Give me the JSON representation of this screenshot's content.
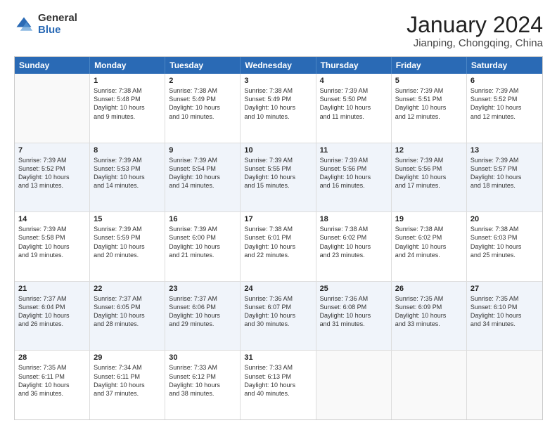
{
  "logo": {
    "general": "General",
    "blue": "Blue"
  },
  "title": "January 2024",
  "subtitle": "Jianping, Chongqing, China",
  "header_days": [
    "Sunday",
    "Monday",
    "Tuesday",
    "Wednesday",
    "Thursday",
    "Friday",
    "Saturday"
  ],
  "weeks": [
    [
      {
        "day": "",
        "info": "",
        "shaded": false,
        "empty": true
      },
      {
        "day": "1",
        "info": "Sunrise: 7:38 AM\nSunset: 5:48 PM\nDaylight: 10 hours\nand 9 minutes.",
        "shaded": false
      },
      {
        "day": "2",
        "info": "Sunrise: 7:38 AM\nSunset: 5:49 PM\nDaylight: 10 hours\nand 10 minutes.",
        "shaded": false
      },
      {
        "day": "3",
        "info": "Sunrise: 7:38 AM\nSunset: 5:49 PM\nDaylight: 10 hours\nand 10 minutes.",
        "shaded": false
      },
      {
        "day": "4",
        "info": "Sunrise: 7:39 AM\nSunset: 5:50 PM\nDaylight: 10 hours\nand 11 minutes.",
        "shaded": false
      },
      {
        "day": "5",
        "info": "Sunrise: 7:39 AM\nSunset: 5:51 PM\nDaylight: 10 hours\nand 12 minutes.",
        "shaded": false
      },
      {
        "day": "6",
        "info": "Sunrise: 7:39 AM\nSunset: 5:52 PM\nDaylight: 10 hours\nand 12 minutes.",
        "shaded": false
      }
    ],
    [
      {
        "day": "7",
        "info": "Sunrise: 7:39 AM\nSunset: 5:52 PM\nDaylight: 10 hours\nand 13 minutes.",
        "shaded": true
      },
      {
        "day": "8",
        "info": "Sunrise: 7:39 AM\nSunset: 5:53 PM\nDaylight: 10 hours\nand 14 minutes.",
        "shaded": true
      },
      {
        "day": "9",
        "info": "Sunrise: 7:39 AM\nSunset: 5:54 PM\nDaylight: 10 hours\nand 14 minutes.",
        "shaded": true
      },
      {
        "day": "10",
        "info": "Sunrise: 7:39 AM\nSunset: 5:55 PM\nDaylight: 10 hours\nand 15 minutes.",
        "shaded": true
      },
      {
        "day": "11",
        "info": "Sunrise: 7:39 AM\nSunset: 5:56 PM\nDaylight: 10 hours\nand 16 minutes.",
        "shaded": true
      },
      {
        "day": "12",
        "info": "Sunrise: 7:39 AM\nSunset: 5:56 PM\nDaylight: 10 hours\nand 17 minutes.",
        "shaded": true
      },
      {
        "day": "13",
        "info": "Sunrise: 7:39 AM\nSunset: 5:57 PM\nDaylight: 10 hours\nand 18 minutes.",
        "shaded": true
      }
    ],
    [
      {
        "day": "14",
        "info": "Sunrise: 7:39 AM\nSunset: 5:58 PM\nDaylight: 10 hours\nand 19 minutes.",
        "shaded": false
      },
      {
        "day": "15",
        "info": "Sunrise: 7:39 AM\nSunset: 5:59 PM\nDaylight: 10 hours\nand 20 minutes.",
        "shaded": false
      },
      {
        "day": "16",
        "info": "Sunrise: 7:39 AM\nSunset: 6:00 PM\nDaylight: 10 hours\nand 21 minutes.",
        "shaded": false
      },
      {
        "day": "17",
        "info": "Sunrise: 7:38 AM\nSunset: 6:01 PM\nDaylight: 10 hours\nand 22 minutes.",
        "shaded": false
      },
      {
        "day": "18",
        "info": "Sunrise: 7:38 AM\nSunset: 6:02 PM\nDaylight: 10 hours\nand 23 minutes.",
        "shaded": false
      },
      {
        "day": "19",
        "info": "Sunrise: 7:38 AM\nSunset: 6:02 PM\nDaylight: 10 hours\nand 24 minutes.",
        "shaded": false
      },
      {
        "day": "20",
        "info": "Sunrise: 7:38 AM\nSunset: 6:03 PM\nDaylight: 10 hours\nand 25 minutes.",
        "shaded": false
      }
    ],
    [
      {
        "day": "21",
        "info": "Sunrise: 7:37 AM\nSunset: 6:04 PM\nDaylight: 10 hours\nand 26 minutes.",
        "shaded": true
      },
      {
        "day": "22",
        "info": "Sunrise: 7:37 AM\nSunset: 6:05 PM\nDaylight: 10 hours\nand 28 minutes.",
        "shaded": true
      },
      {
        "day": "23",
        "info": "Sunrise: 7:37 AM\nSunset: 6:06 PM\nDaylight: 10 hours\nand 29 minutes.",
        "shaded": true
      },
      {
        "day": "24",
        "info": "Sunrise: 7:36 AM\nSunset: 6:07 PM\nDaylight: 10 hours\nand 30 minutes.",
        "shaded": true
      },
      {
        "day": "25",
        "info": "Sunrise: 7:36 AM\nSunset: 6:08 PM\nDaylight: 10 hours\nand 31 minutes.",
        "shaded": true
      },
      {
        "day": "26",
        "info": "Sunrise: 7:35 AM\nSunset: 6:09 PM\nDaylight: 10 hours\nand 33 minutes.",
        "shaded": true
      },
      {
        "day": "27",
        "info": "Sunrise: 7:35 AM\nSunset: 6:10 PM\nDaylight: 10 hours\nand 34 minutes.",
        "shaded": true
      }
    ],
    [
      {
        "day": "28",
        "info": "Sunrise: 7:35 AM\nSunset: 6:11 PM\nDaylight: 10 hours\nand 36 minutes.",
        "shaded": false
      },
      {
        "day": "29",
        "info": "Sunrise: 7:34 AM\nSunset: 6:11 PM\nDaylight: 10 hours\nand 37 minutes.",
        "shaded": false
      },
      {
        "day": "30",
        "info": "Sunrise: 7:33 AM\nSunset: 6:12 PM\nDaylight: 10 hours\nand 38 minutes.",
        "shaded": false
      },
      {
        "day": "31",
        "info": "Sunrise: 7:33 AM\nSunset: 6:13 PM\nDaylight: 10 hours\nand 40 minutes.",
        "shaded": false
      },
      {
        "day": "",
        "info": "",
        "shaded": false,
        "empty": true
      },
      {
        "day": "",
        "info": "",
        "shaded": false,
        "empty": true
      },
      {
        "day": "",
        "info": "",
        "shaded": false,
        "empty": true
      }
    ]
  ]
}
